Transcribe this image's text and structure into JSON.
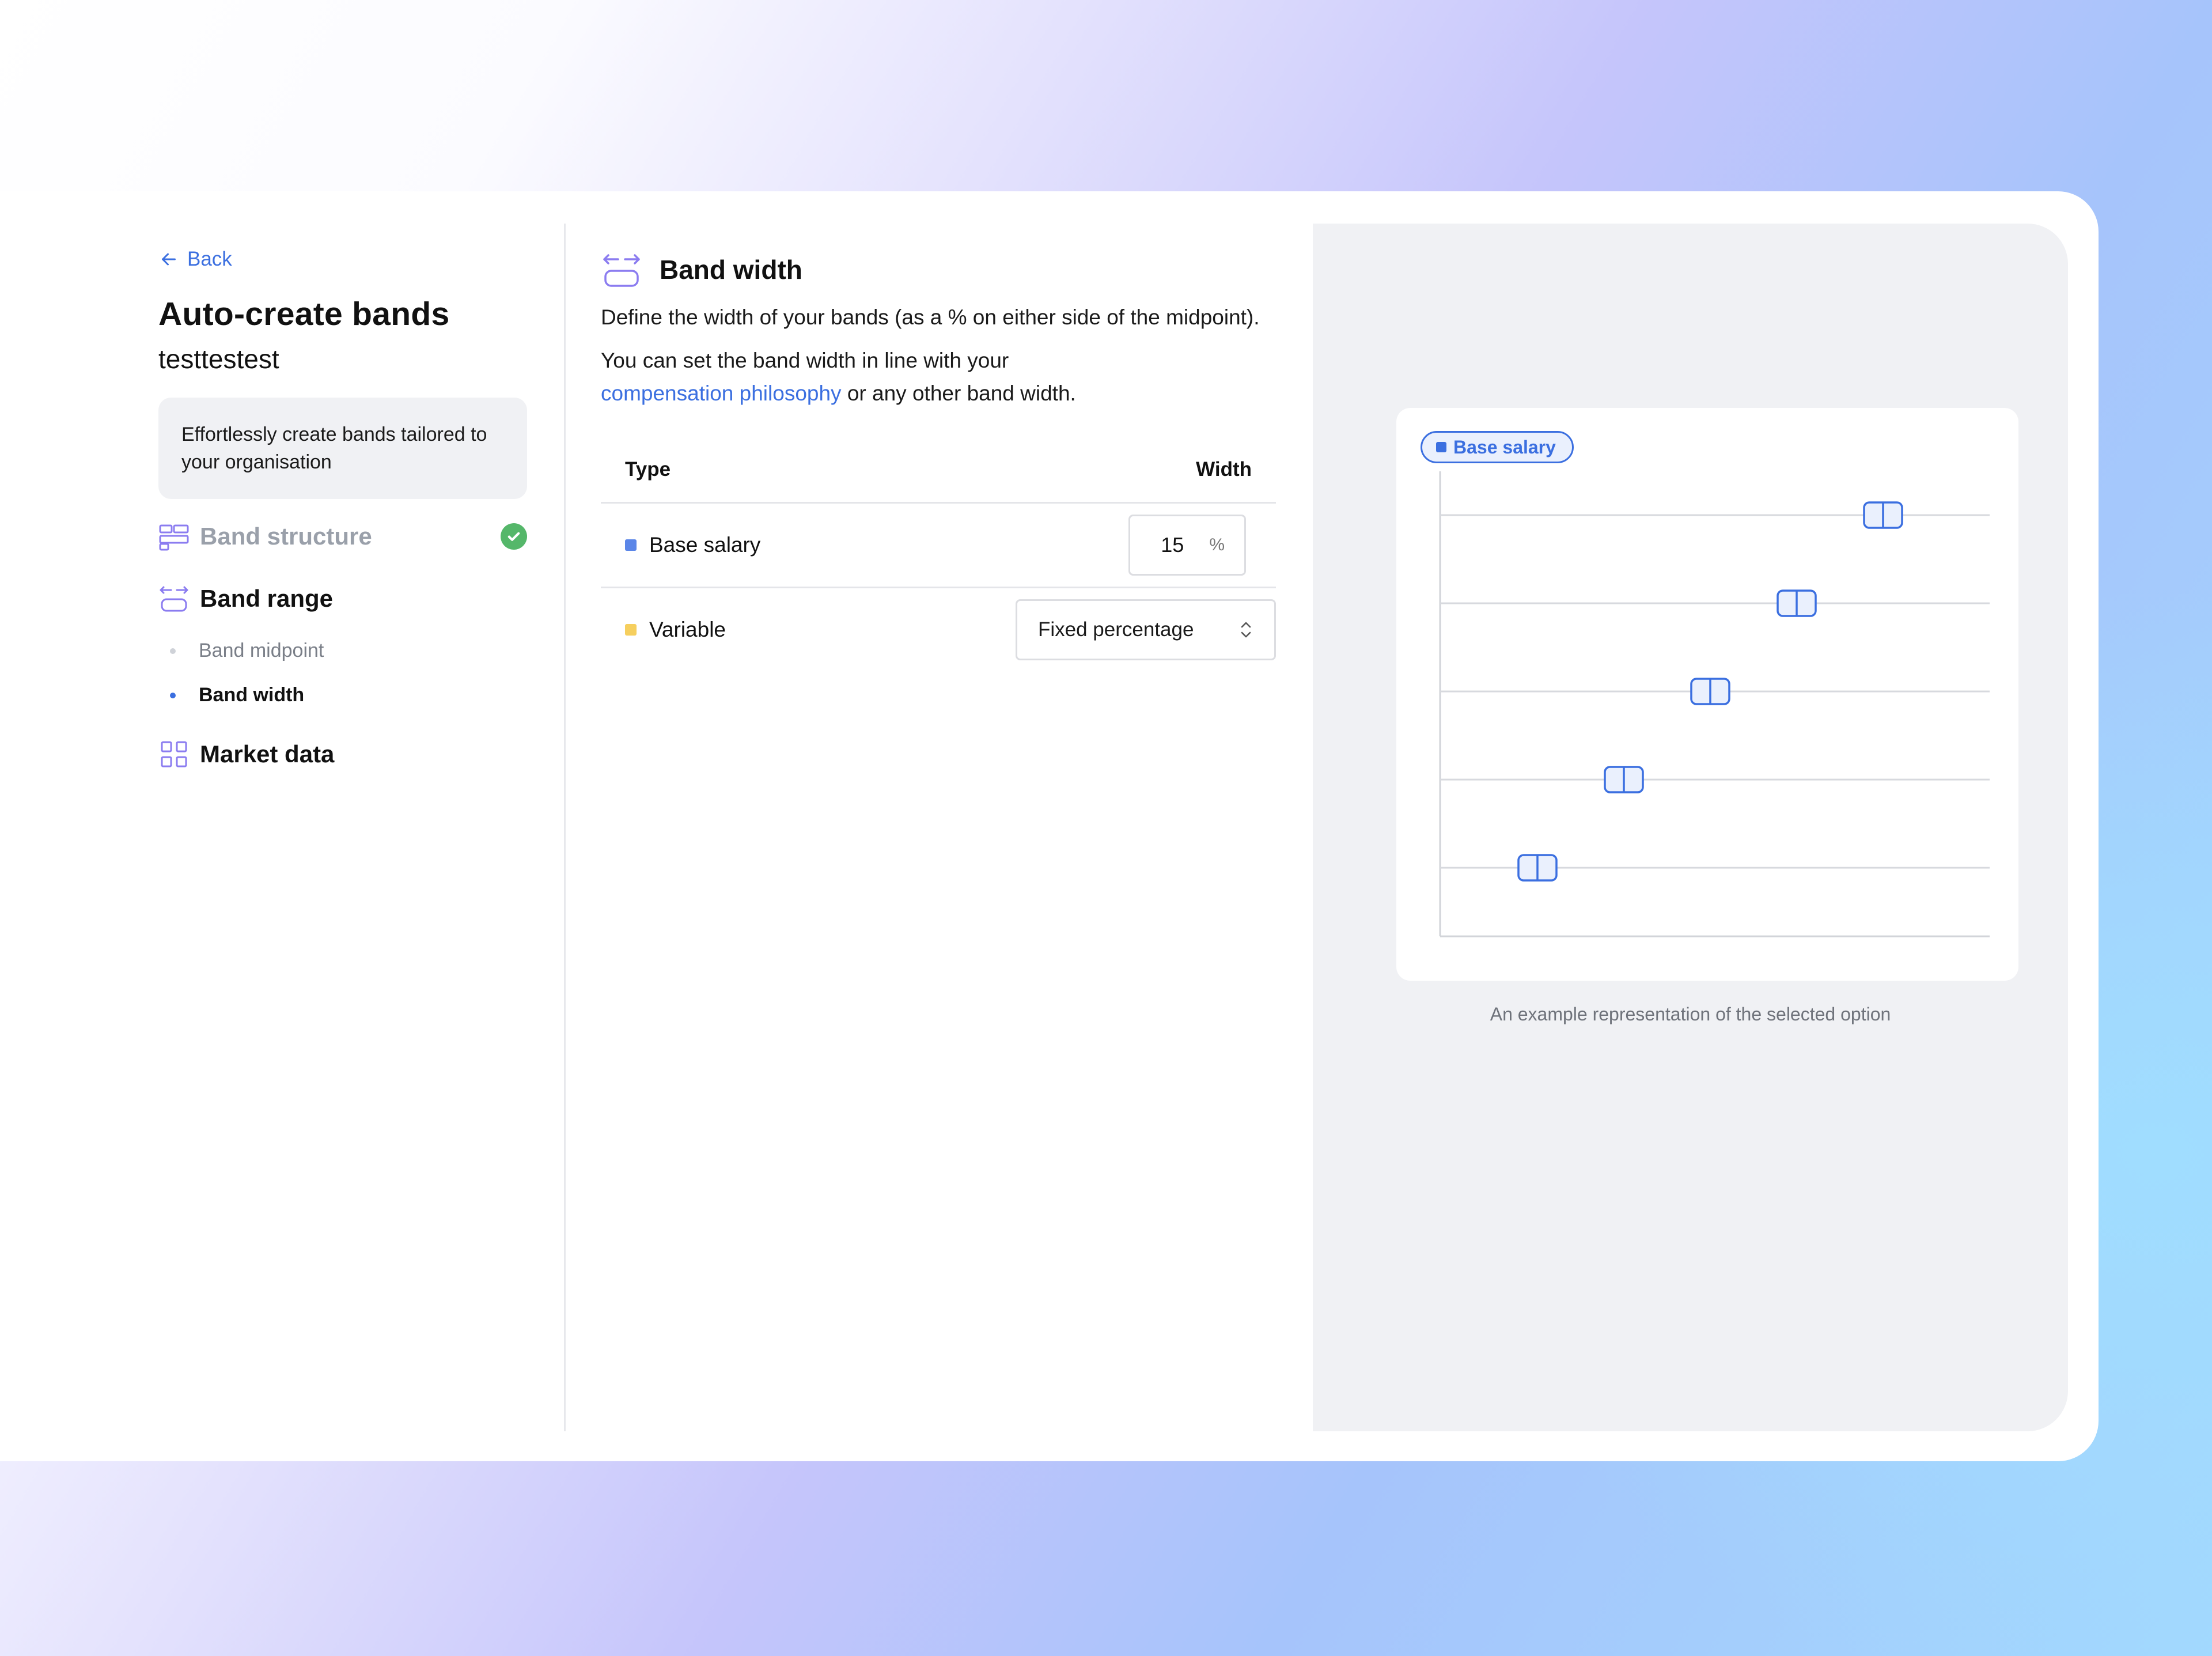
{
  "sidebar": {
    "back_label": "Back",
    "title": "Auto-create bands",
    "subtitle": "testtestest",
    "info_text": "Effortlessly create bands tailored to your organisation",
    "steps": [
      {
        "label": "Band structure",
        "icon": "band-structure-icon",
        "status": "complete"
      },
      {
        "label": "Band range",
        "icon": "band-range-icon",
        "status": "active",
        "substeps": [
          {
            "label": "Band midpoint",
            "status": "inactive"
          },
          {
            "label": "Band width",
            "status": "active"
          }
        ]
      },
      {
        "label": "Market data",
        "icon": "grid-icon",
        "status": "pending"
      }
    ]
  },
  "main": {
    "title": "Band width",
    "icon": "band-width-icon",
    "description": "Define the width of your bands (as a % on either side of the midpoint).",
    "hint_prefix": "You can set the band width in line with your",
    "hint_link": "compensation philosophy",
    "hint_suffix": "or any other band width.",
    "table": {
      "col_type": "Type",
      "col_width": "Width",
      "rows": [
        {
          "type": "Base salary",
          "color": "#5b86e8",
          "value": "15",
          "unit": "%"
        },
        {
          "type": "Variable",
          "color": "#f6cf5e",
          "select_value": "Fixed percentage"
        }
      ]
    }
  },
  "preview": {
    "legend_label": "Base salary",
    "legend_color": "#3b6fe0",
    "caption": "An example representation of the selected option",
    "band_count": 5
  },
  "colors": {
    "accent": "#3b6fe0",
    "success": "#55b76a",
    "icon_purple": "#8b7cf0"
  }
}
